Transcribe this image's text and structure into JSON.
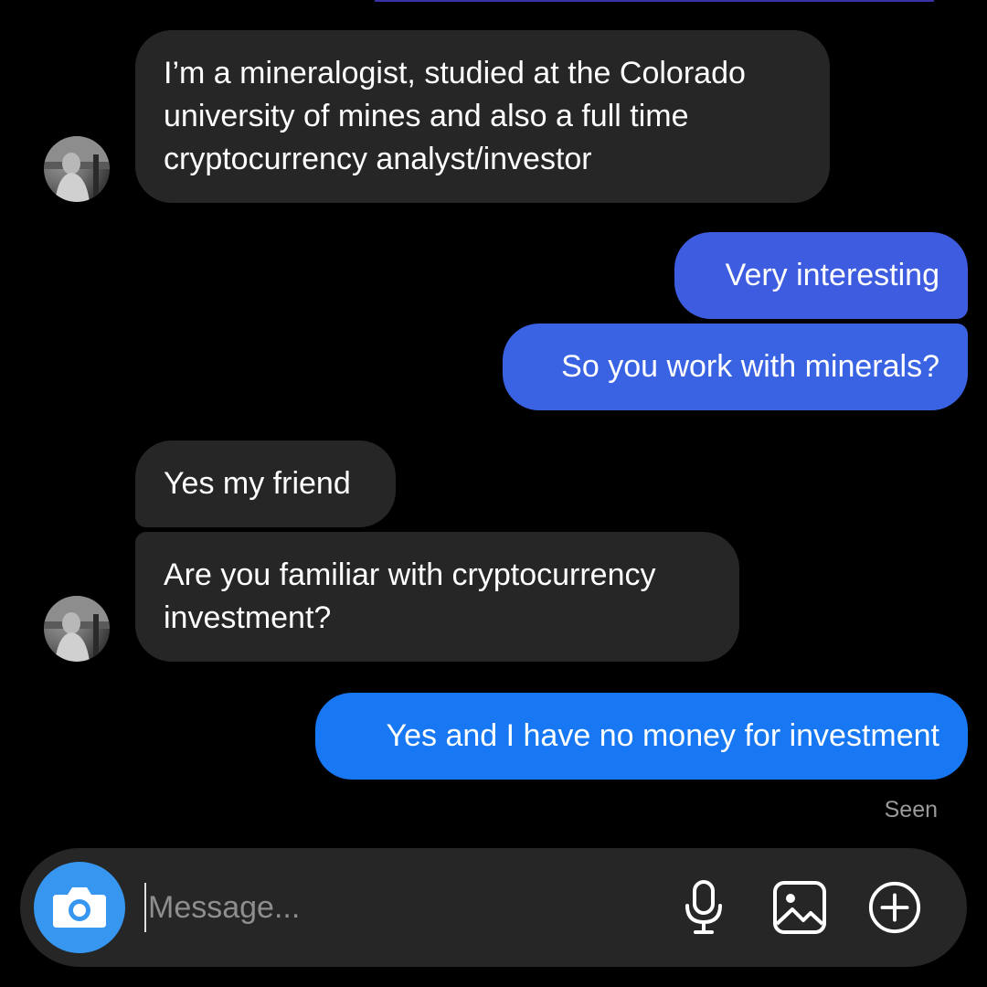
{
  "colors": {
    "background": "#000000",
    "incoming_bubble": "#262626",
    "outgoing_bubble_top": "#3d5ce0",
    "outgoing_bubble_bottom": "#1877f2",
    "camera_button": "#3797f0",
    "seen_text": "#9a9a9a"
  },
  "messages": [
    {
      "direction": "incoming",
      "text": "I’m a mineralogist, studied at the Colorado university of mines and also a full time cryptocurrency analyst/investor"
    },
    {
      "direction": "outgoing",
      "text": "Very interesting"
    },
    {
      "direction": "outgoing",
      "text": "So you work with minerals?"
    },
    {
      "direction": "incoming",
      "text": "Yes my friend"
    },
    {
      "direction": "incoming",
      "text": "Are you familiar with cryptocurrency investment?"
    },
    {
      "direction": "outgoing",
      "text": "Yes and I have no money for investment"
    }
  ],
  "status": {
    "seen_label": "Seen"
  },
  "composer": {
    "placeholder": "Message...",
    "value": "",
    "icons": {
      "camera": "camera-icon",
      "microphone": "microphone-icon",
      "gallery": "gallery-icon",
      "add": "plus-circle-icon"
    }
  }
}
